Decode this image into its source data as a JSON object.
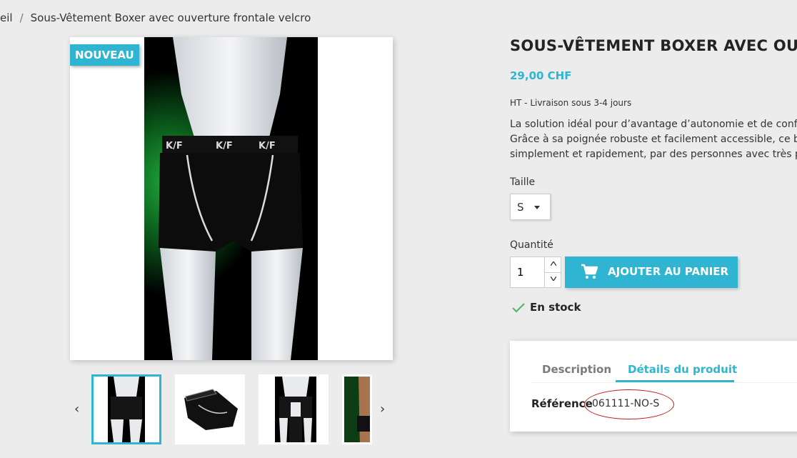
{
  "breadcrumb": {
    "home": "eil",
    "separator": "/",
    "current": "Sous-Vêtement Boxer avec ouverture frontale velcro"
  },
  "product": {
    "badge": "NOUVEAU",
    "title": "SOUS-VÊTEMENT BOXER AVEC OUVER",
    "price": "29,00 CHF",
    "tax_delivery": "HT  - Livraison sous 3-4 jours",
    "description_lines": [
      "La solution idéal pour d’avantage d’autonomie et de conf",
      "Grâce à sa poignée robuste et facilement accessible, ce bo",
      "simplement et rapidement, par des personnes avec très p"
    ],
    "size_label": "Taille",
    "size_value": "S",
    "quantity_label": "Quantité",
    "quantity_value": "1",
    "add_to_cart": "AJOUTER AU PANIER",
    "stock": "En stock"
  },
  "tabs": {
    "description": "Description",
    "details": "Détails du produit",
    "reference_label": "Référence",
    "reference_value": "061111-NO-S"
  },
  "icons": {
    "cart": "shopping-cart-icon",
    "check": "check-icon",
    "prev": "chevron-left-icon",
    "next": "chevron-right-icon"
  },
  "colors": {
    "accent": "#2fb5d2",
    "annotation": "#c21b1b",
    "background": "#ececec"
  }
}
